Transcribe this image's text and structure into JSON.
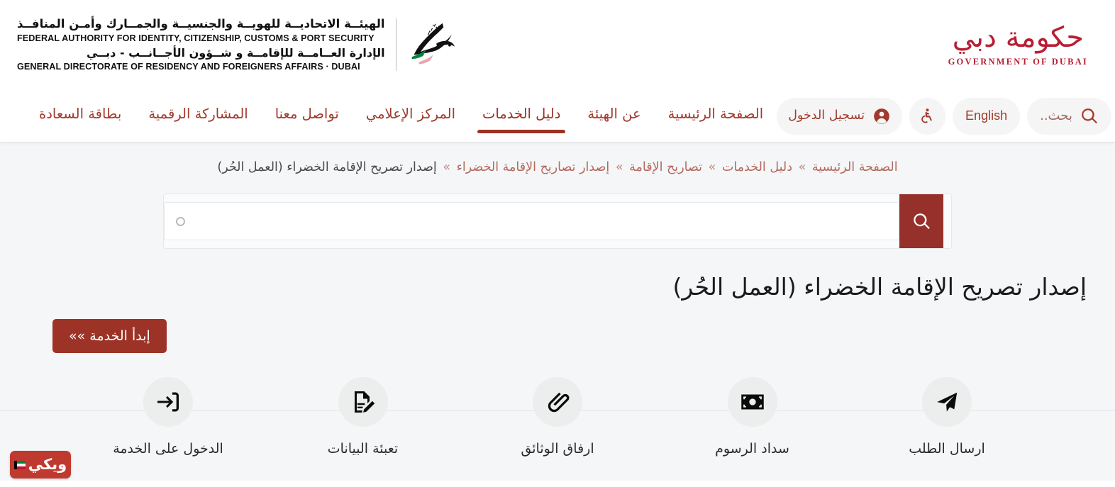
{
  "header": {
    "gov_logo": {
      "arabic_script": "حكومة دبي",
      "latin_text": "GOVERNMENT OF DUBAI"
    },
    "federal_logo": {
      "arabic_line1": "الهيئــة الاتحاديــة للهويــة والجنسيــة والجمــارك وأمـن المنافــذ",
      "english_line1": "FEDERAL AUTHORITY FOR IDENTITY, CITIZENSHIP, CUSTOMS & PORT SECURITY",
      "arabic_line2": "الإدارة العــامــة للإقامــة و شــؤون الأجــانــب - دبــي",
      "english_line2": "GENERAL DIRECTORATE OF RESIDENCY AND FOREIGNERS AFFAIRS · DUBAI"
    }
  },
  "nav": {
    "items": [
      {
        "label": "الصفحة الرئيسية",
        "active": false
      },
      {
        "label": "عن الهيئة",
        "active": false
      },
      {
        "label": "دليل الخدمات",
        "active": true
      },
      {
        "label": "المركز الإعلامي",
        "active": false
      },
      {
        "label": "تواصل معنا",
        "active": false
      },
      {
        "label": "المشاركة الرقمية",
        "active": false
      },
      {
        "label": "بطاقة السعادة",
        "active": false
      }
    ],
    "tools": {
      "search_label": "بحث..",
      "search_icon": "magnifier-icon",
      "language_label": "English",
      "accessibility_icon": "wheelchair-icon",
      "login_label": "تسجيل الدخول",
      "login_icon": "user-account-icon"
    }
  },
  "breadcrumb": {
    "separator": "»",
    "items": [
      "الصفحة الرئيسية",
      "دليل الخدمات",
      "تصاريح الإقامة",
      "إصدار تصاريح الإقامة الخضراء",
      "إصدار تصريح الإقامة الخضراء (العمل الحُر)"
    ]
  },
  "search_panel": {
    "value": "",
    "placeholder": "",
    "button_icon": "search-icon"
  },
  "main": {
    "title": "إصدار تصريح الإقامة الخضراء (العمل الحُر)",
    "start_button_label": "إبدأ الخدمة »»"
  },
  "steps": [
    {
      "label": "الدخول على الخدمة",
      "icon": "sign-in-icon"
    },
    {
      "label": "تعبئة البيانات",
      "icon": "document-edit-icon"
    },
    {
      "label": "ارفاق الوثائق",
      "icon": "paperclip-icon"
    },
    {
      "label": "سداد الرسوم",
      "icon": "banknote-icon"
    },
    {
      "label": "ارسال الطلب",
      "icon": "paper-plane-icon"
    }
  ],
  "watermark": {
    "label": "ويكي",
    "flag_icon": "uae-flag-icon"
  },
  "colors": {
    "brand_red": "#9c3326",
    "gov_red": "#b81f34",
    "nav_link": "#a13a2c",
    "page_bg": "#f5f6f8",
    "breadcrumb_text": "#b36a5e"
  }
}
